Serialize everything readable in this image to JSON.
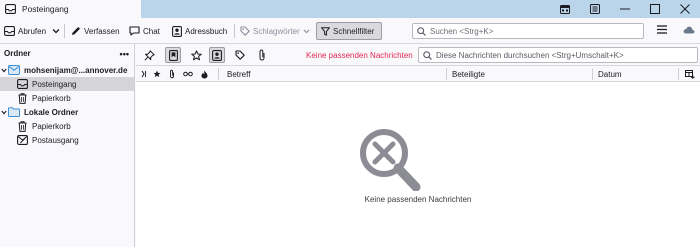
{
  "window": {
    "tab_title": "Posteingang"
  },
  "toolbar": {
    "get_messages": "Abrufen",
    "write": "Verfassen",
    "chat": "Chat",
    "address_book": "Adressbuch",
    "tags": "Schlagwörter",
    "quick_filter": "Schnellfilter",
    "search_placeholder": "Suchen <Strg+K>"
  },
  "folder_pane": {
    "header": "Ordner",
    "more": "•••",
    "folders": [
      {
        "label": "mohsenijam@...annover.de",
        "icon": "account-mail-icon",
        "level": 0,
        "bold": true,
        "expanded": true
      },
      {
        "label": "Posteingang",
        "icon": "inbox-icon",
        "level": 1,
        "selected": true
      },
      {
        "label": "Papierkorb",
        "icon": "trash-icon",
        "level": 1
      },
      {
        "label": "Lokale Ordner",
        "icon": "folder-icon",
        "level": 0,
        "bold": true,
        "expanded": true
      },
      {
        "label": "Papierkorb",
        "icon": "trash-icon",
        "level": 1
      },
      {
        "label": "Postausgang",
        "icon": "outbox-icon",
        "level": 1
      }
    ]
  },
  "quick_filter_bar": {
    "no_results": "Keine passenden Nachrichten",
    "search_placeholder": "Diese Nachrichten durchsuchen <Strg+Umschalt+K>",
    "buttons": [
      "sticky-pin-icon",
      "unread-filter-icon",
      "starred-filter-icon",
      "contact-filter-icon",
      "tag-filter-icon",
      "attachment-filter-icon"
    ]
  },
  "thread_columns": {
    "subject": "Betreff",
    "correspondents": "Beteiligte",
    "date": "Datum"
  },
  "message_list": {
    "empty_text": "Keine passenden Nachrichten"
  },
  "colors": {
    "titlebar": "#bad5ea",
    "no_results_red": "#e22850",
    "selected_row": "#d4d4d9",
    "folder_blue": "#3b8fd9"
  }
}
